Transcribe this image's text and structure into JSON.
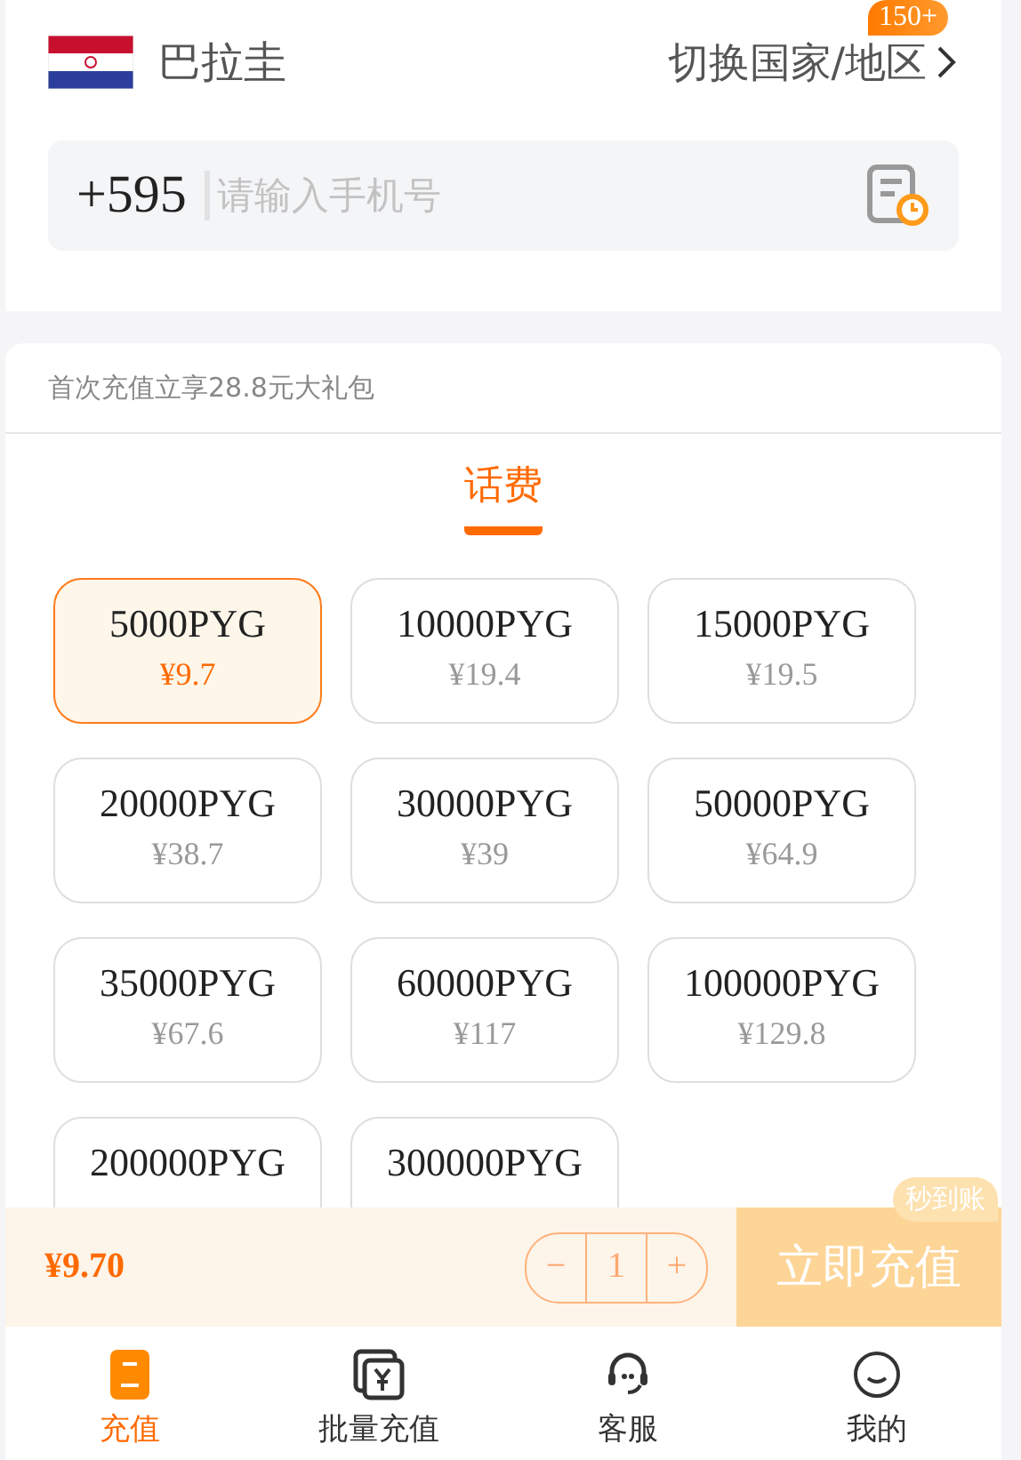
{
  "header": {
    "country": "巴拉圭",
    "switch_label": "切换国家/地区",
    "switch_badge": "150+"
  },
  "phone": {
    "code": "+595",
    "placeholder": "请输入手机号"
  },
  "promo": "首次充值立享28.8元大礼包",
  "tabs": [
    {
      "label": "话费",
      "selected": true
    }
  ],
  "plans": [
    {
      "amount": "5000PYG",
      "price": "¥9.7",
      "selected": true
    },
    {
      "amount": "10000PYG",
      "price": "¥19.4",
      "selected": false
    },
    {
      "amount": "15000PYG",
      "price": "¥19.5",
      "selected": false
    },
    {
      "amount": "20000PYG",
      "price": "¥38.7",
      "selected": false
    },
    {
      "amount": "30000PYG",
      "price": "¥39",
      "selected": false
    },
    {
      "amount": "50000PYG",
      "price": "¥64.9",
      "selected": false
    },
    {
      "amount": "35000PYG",
      "price": "¥67.6",
      "selected": false
    },
    {
      "amount": "60000PYG",
      "price": "¥117",
      "selected": false
    },
    {
      "amount": "100000PYG",
      "price": "¥129.8",
      "selected": false
    },
    {
      "amount": "200000PYG",
      "selected": false
    },
    {
      "amount": "300000PYG",
      "selected": false
    }
  ],
  "checkout": {
    "total": "¥9.70",
    "decrement": "−",
    "quantity": "1",
    "increment": "+",
    "submit": "立即充值",
    "submit_disabled": true,
    "submit_badge": "秒到账"
  },
  "nav": [
    {
      "label": "充值",
      "selected": true
    },
    {
      "label": "批量充值",
      "selected": false
    },
    {
      "label": "客服",
      "selected": false
    },
    {
      "label": "我的",
      "selected": false
    }
  ]
}
